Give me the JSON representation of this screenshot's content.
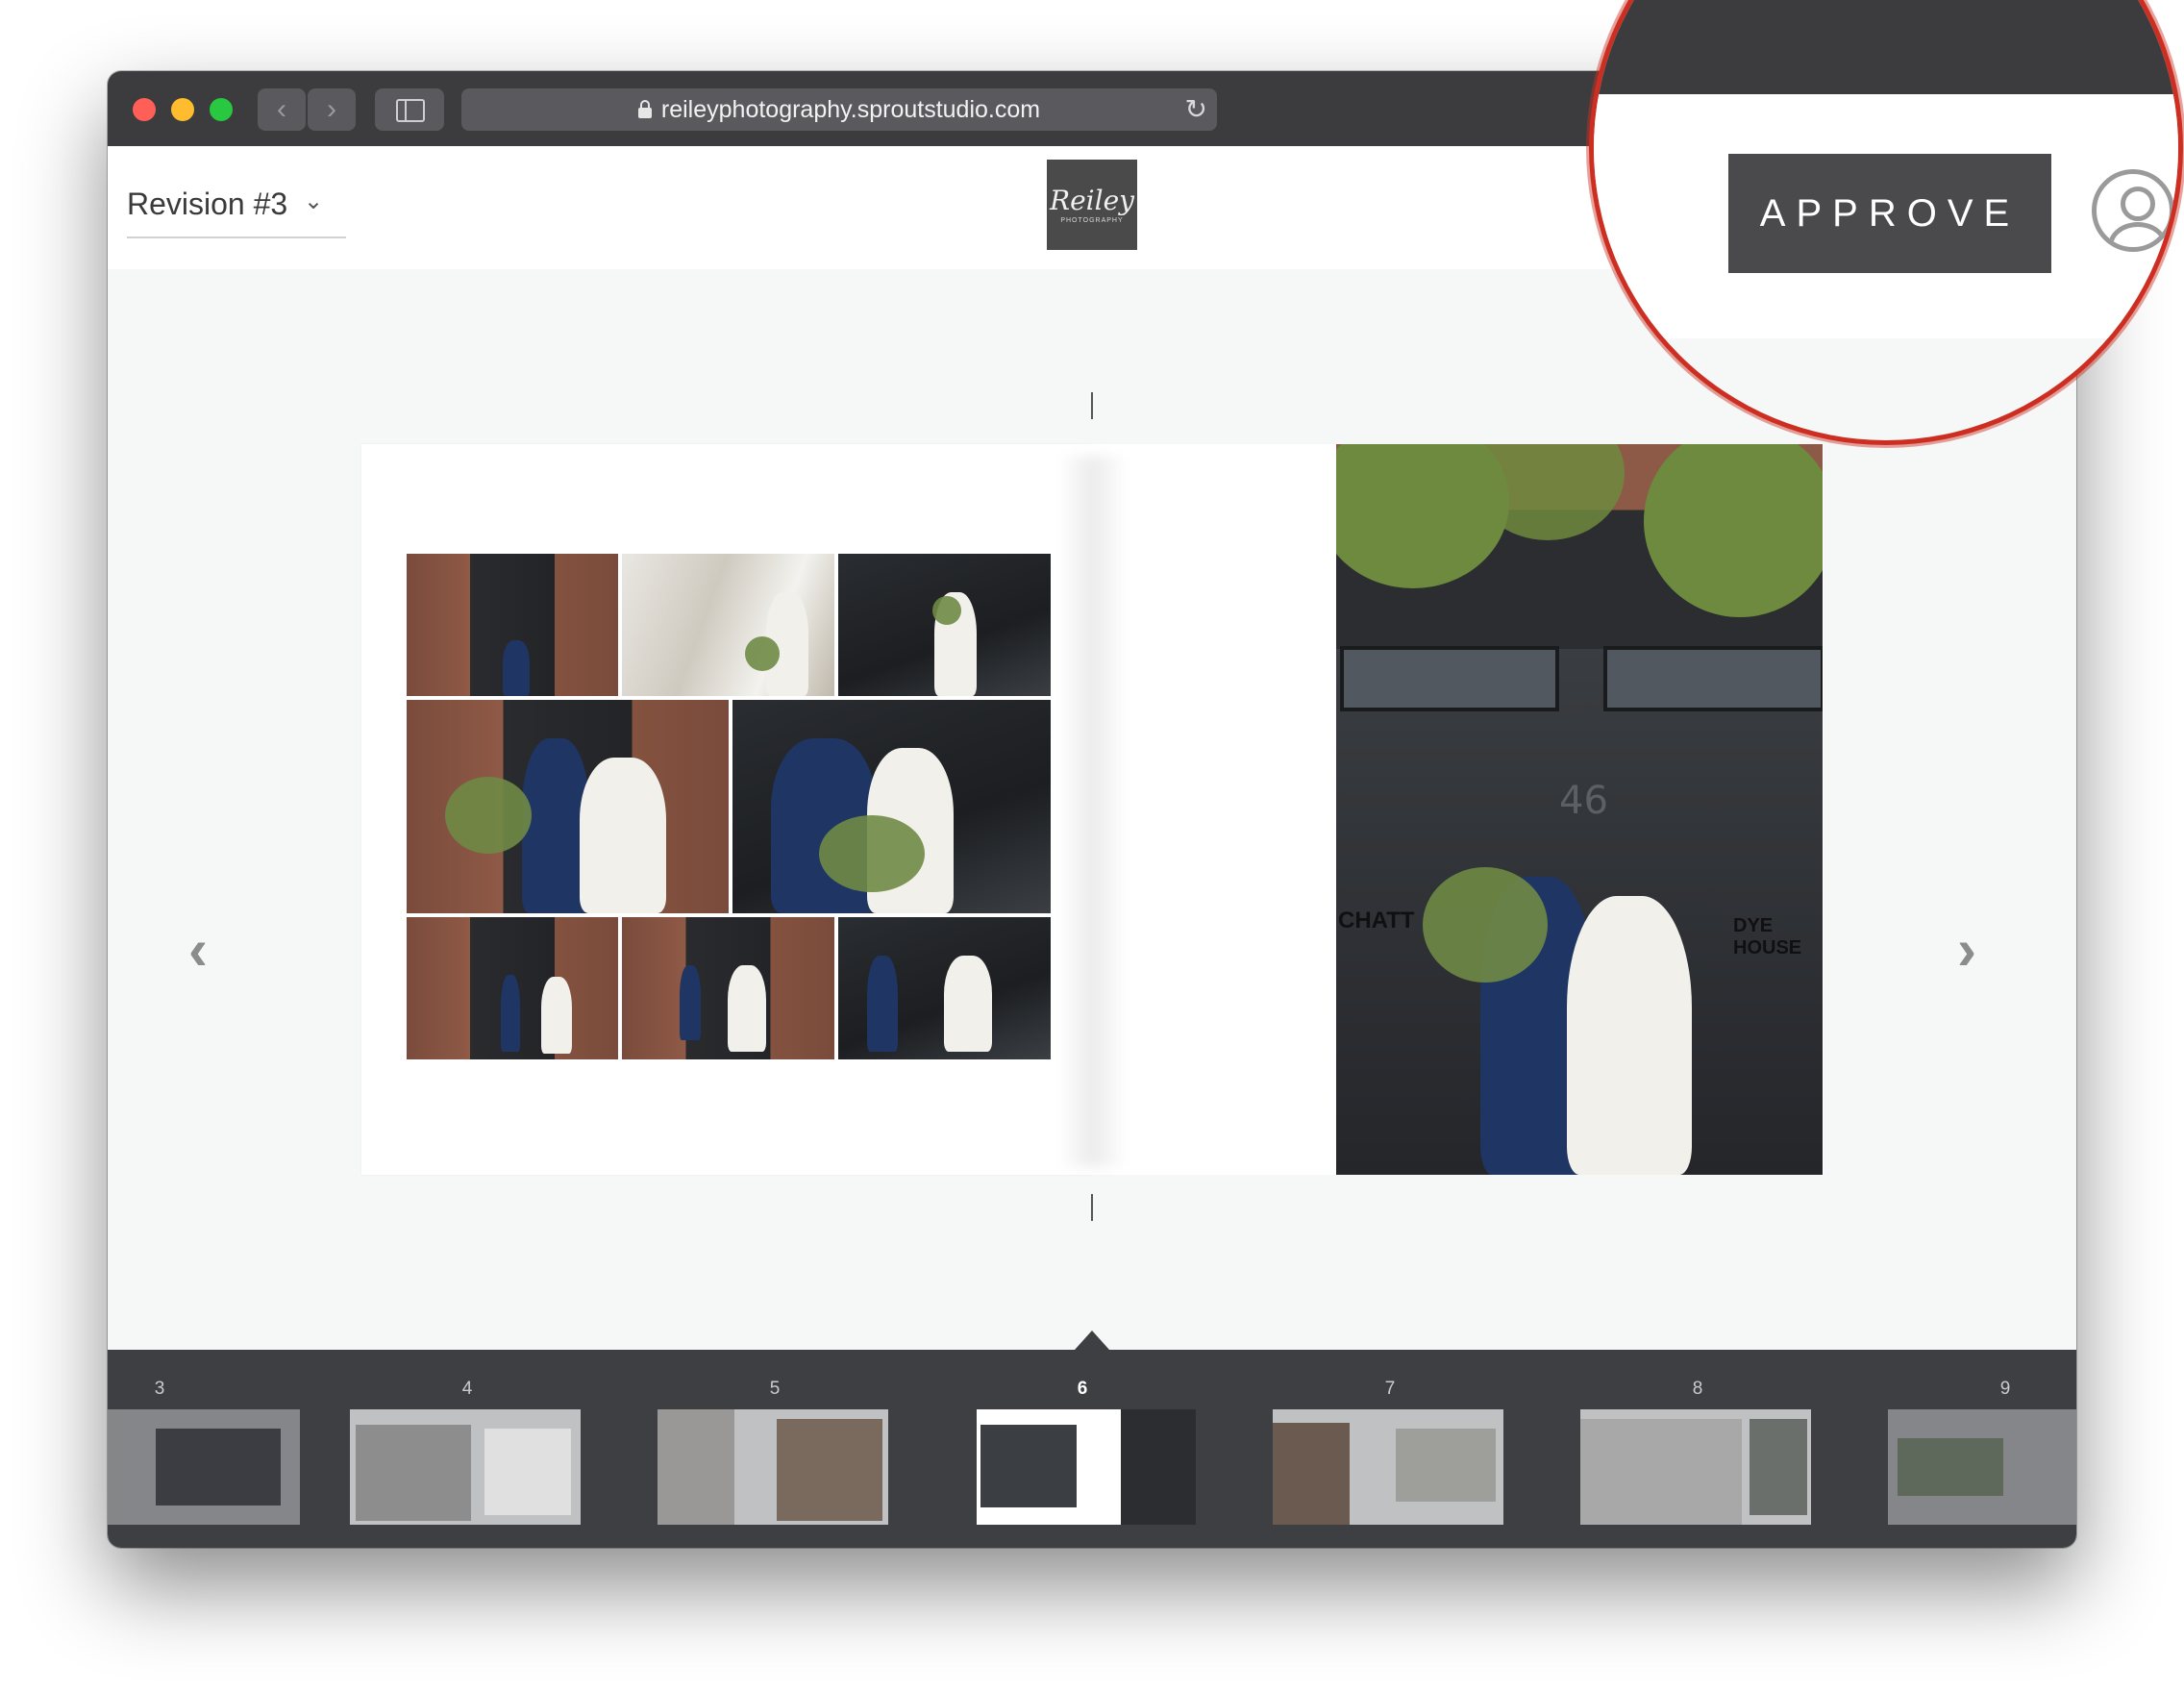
{
  "browser": {
    "url": "reileyphotography.sproutstudio.com",
    "back_icon": "chevron-left-icon",
    "forward_icon": "chevron-right-icon",
    "sidebar_icon": "sidebar-icon",
    "reload_icon": "reload-icon",
    "back_glyph": "‹",
    "forward_glyph": "›",
    "reload_glyph": "↻"
  },
  "header": {
    "revision_label": "Revision #3",
    "revision_chevron": "⌄",
    "logo_script": "Reiley",
    "logo_sub": "PHOTOGRAPHY"
  },
  "spread": {
    "hero_number": "46",
    "hero_sign_left": "CHATT",
    "hero_sign_right": "DYE HOUSE"
  },
  "navigation": {
    "prev_glyph": "‹",
    "next_glyph": "›"
  },
  "filmstrip": {
    "pages": [
      "3",
      "4",
      "5",
      "6",
      "7",
      "8",
      "9"
    ],
    "active": "6"
  },
  "magnified": {
    "approve_label": "APPROVE",
    "user_icon": "user-avatar-icon"
  },
  "colors": {
    "accent": "#4a4a4c",
    "highlight_ring": "#cc2f22"
  }
}
